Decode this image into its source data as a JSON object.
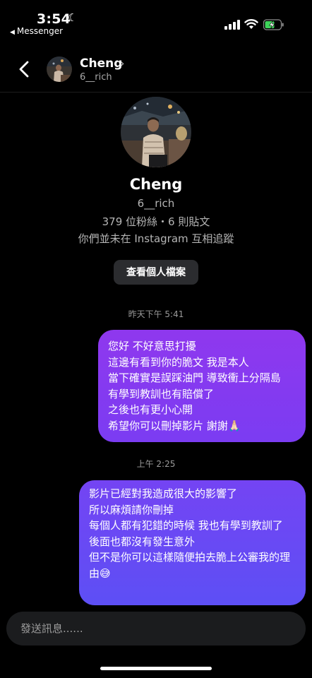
{
  "status_bar": {
    "time": "3:54",
    "back_app": "Messenger"
  },
  "header": {
    "name": "Cheng",
    "username": "6__rich"
  },
  "profile": {
    "name": "Cheng",
    "username": "6__rich",
    "stats": "379 位粉絲・6 則貼文",
    "mutual": "你們並未在 Instagram 互相追蹤",
    "view_profile_label": "查看個人檔案"
  },
  "messages": [
    {
      "timestamp": "昨天下午 5:41",
      "lines": [
        "您好 不好意思打擾",
        "這邊有看到你的脆文 我是本人",
        "當下確實是誤踩油門 導致衝上分隔島",
        "有學到教訓也有賠償了",
        "之後也有更小心開",
        "希望你可以刪掉影片 謝謝🙏🏻"
      ]
    },
    {
      "timestamp": "上午 2:25",
      "lines": [
        "影片已經對我造成很大的影響了",
        "所以麻煩請你刪掉",
        "每個人都有犯錯的時候  我也有學到教訓了",
        "後面也都沒有發生意外",
        "但不是你可以這樣隨便拍去脆上公審我的理由😅"
      ]
    }
  ],
  "composer": {
    "placeholder": "發送訊息......"
  },
  "colors": {
    "bubble_1": "#8f38ee",
    "bubble_2": "#6a48f4",
    "background": "#000000"
  }
}
